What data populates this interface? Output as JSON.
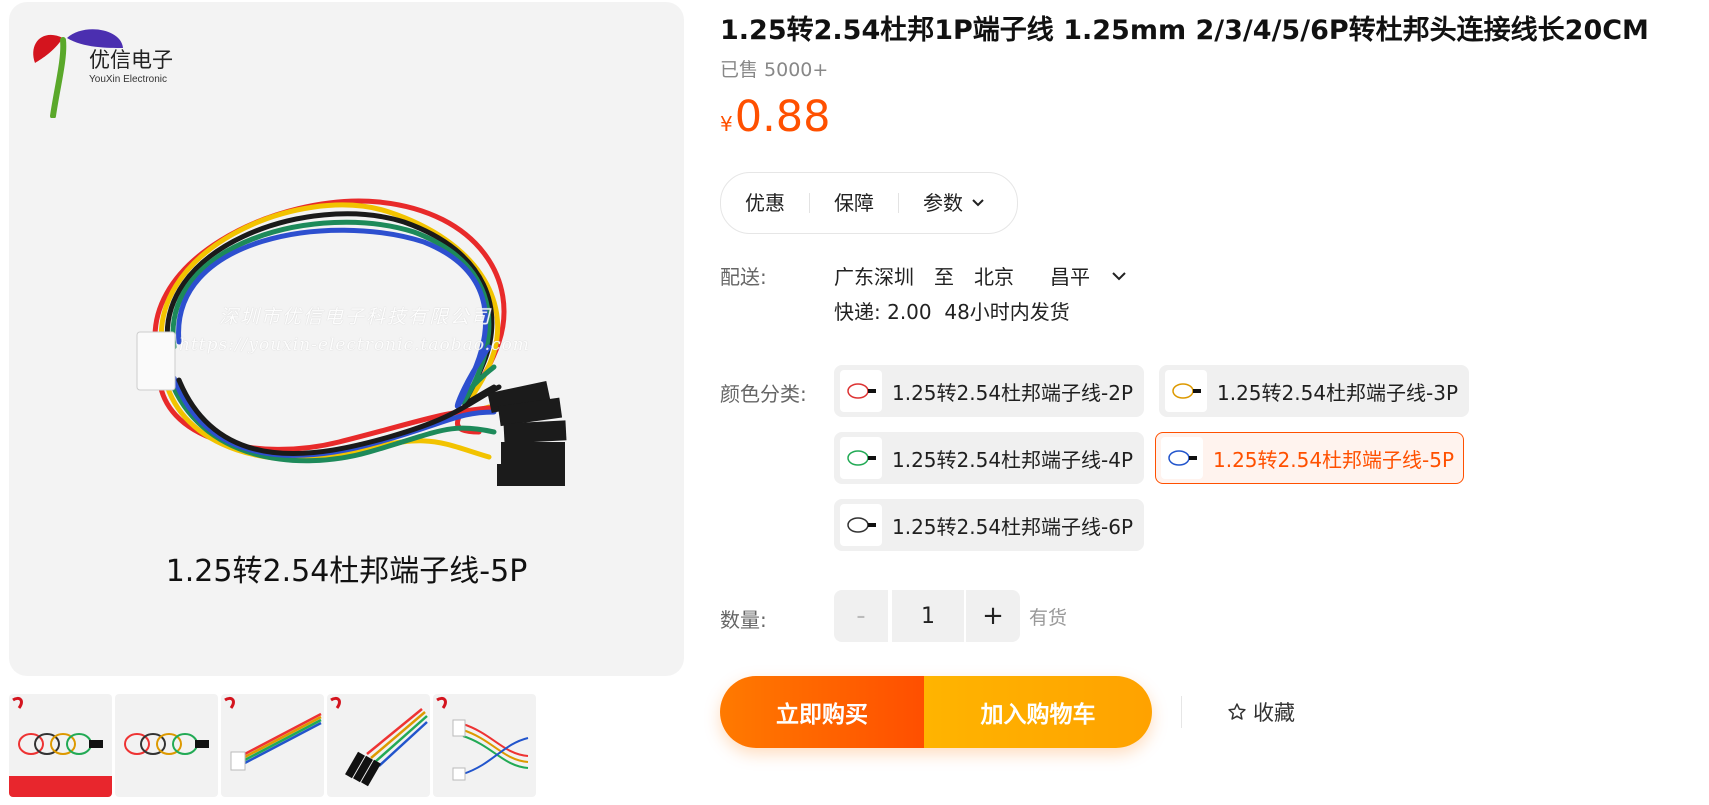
{
  "product": {
    "title": "1.25转2.54杜邦1P端子线 1.25mm 2/3/4/5/6P转杜邦头连接线长20CM",
    "sold": "已售 5000+",
    "price_currency": "¥",
    "price": "0.88"
  },
  "gallery": {
    "logo_cn": "优信电子",
    "logo_en": "YouXin Electronic",
    "watermark_cn": "深圳市优信电子科技有限公司",
    "watermark_url": "https://youxin-electronic.taobao.com",
    "caption": "1.25转2.54杜邦端子线-5P",
    "thumb_count": 5
  },
  "tabs": [
    {
      "label": "优惠"
    },
    {
      "label": "保障"
    },
    {
      "label": "参数",
      "icon": "chevron-down-icon"
    }
  ],
  "shipping": {
    "label": "配送:",
    "from": "广东深圳",
    "to_word": "至",
    "city": "北京",
    "district": "昌平",
    "express": "快递: 2.00",
    "dispatch": "48小时内发货"
  },
  "sku": {
    "label": "颜色分类:",
    "options": [
      {
        "label": "1.25转2.54杜邦端子线-2P",
        "selected": false
      },
      {
        "label": "1.25转2.54杜邦端子线-3P",
        "selected": false
      },
      {
        "label": "1.25转2.54杜邦端子线-4P",
        "selected": false
      },
      {
        "label": "1.25转2.54杜邦端子线-5P",
        "selected": true
      },
      {
        "label": "1.25转2.54杜邦端子线-6P",
        "selected": false
      }
    ]
  },
  "quantity": {
    "label": "数量:",
    "minus": "-",
    "value": "1",
    "plus": "+",
    "stock": "有货"
  },
  "actions": {
    "buy_now": "立即购买",
    "add_cart": "加入购物车",
    "favorite": "收藏"
  },
  "colors": {
    "accent": "#ff5000",
    "buy_now": "#ff6a00",
    "add_cart": "#ffb000"
  }
}
